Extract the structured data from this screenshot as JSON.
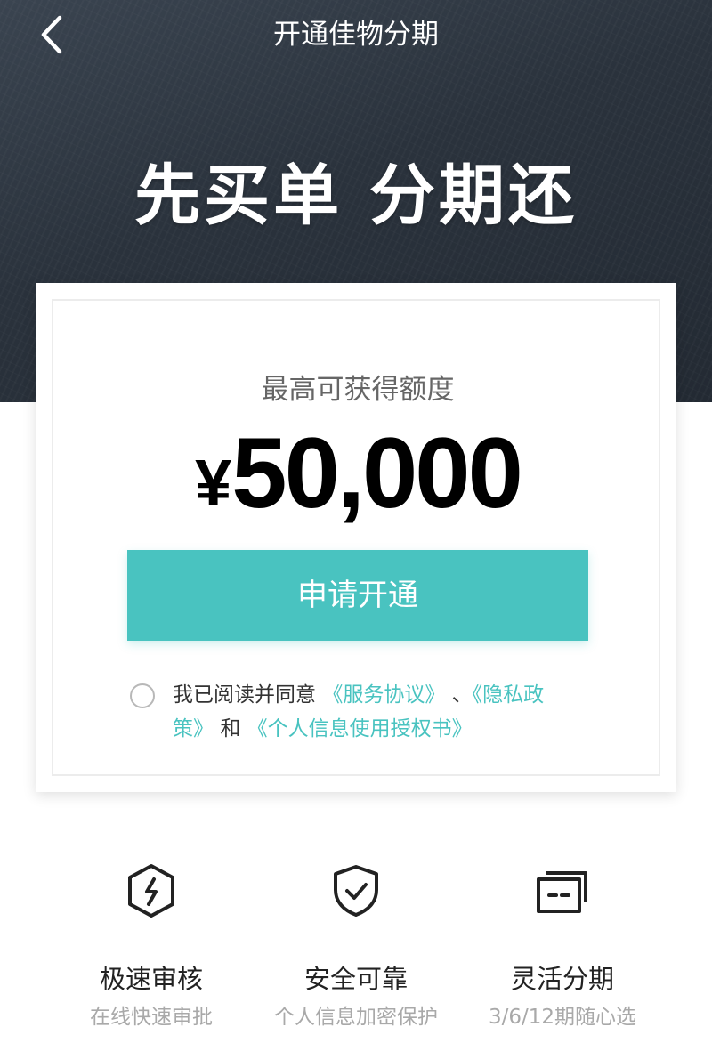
{
  "nav": {
    "back_icon": "chevron-left-icon",
    "title": "开通佳物分期"
  },
  "hero": {
    "slogan": "先买单 分期还"
  },
  "card": {
    "limit_label": "最高可获得额度",
    "limit_currency": "¥",
    "limit_amount": "50,000",
    "apply_label": "申请开通",
    "agreement": {
      "prefix": "我已阅读并同意",
      "link_service": "《服务协议》",
      "sep": "、",
      "link_privacy": "《隐私政策》",
      "and": "和",
      "link_authorization": "《个人信息使用授权书》"
    }
  },
  "features": [
    {
      "icon": "lightning-hexagon-icon",
      "title": "极速审核",
      "subtitle": "在线快速审批"
    },
    {
      "icon": "shield-check-icon",
      "title": "安全可靠",
      "subtitle": "个人信息加密保护"
    },
    {
      "icon": "stacked-cards-icon",
      "title": "灵活分期",
      "subtitle": "3/6/12期随心选"
    }
  ],
  "colors": {
    "accent": "#49c3c0",
    "hero_bg": "#2a323c"
  }
}
